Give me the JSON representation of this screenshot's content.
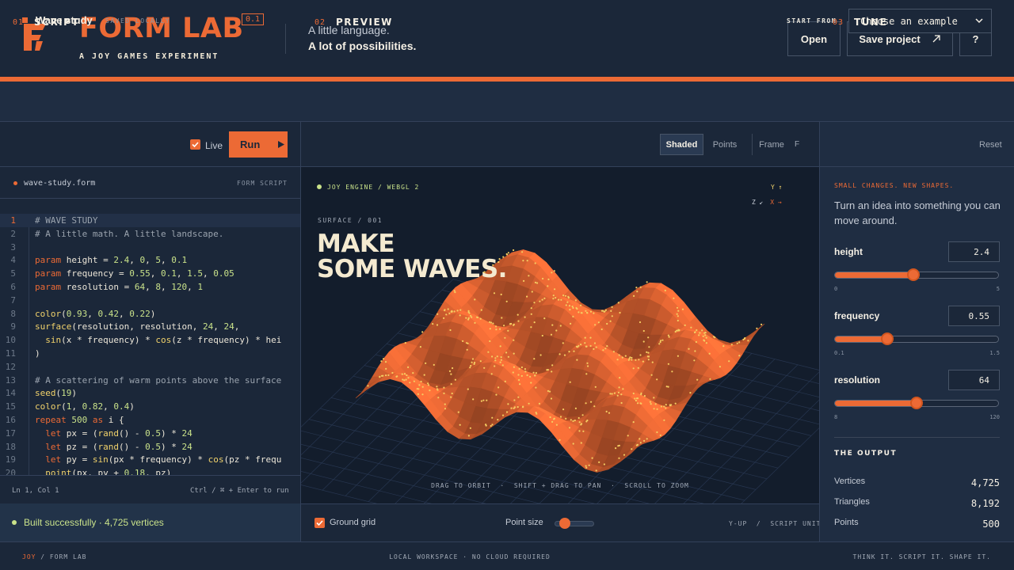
{
  "header": {
    "brand": "FORM LAB",
    "version": "0.1",
    "subtitle": "A JOY GAMES EXPERIMENT",
    "tagline_1": "A little language.",
    "tagline_2": "A lot of possibilities.",
    "open_label": "Open",
    "save_label": "Save project",
    "help_label": "?"
  },
  "project": {
    "name": "Wave study",
    "status": "SAVED LOCALLY",
    "start_from_label": "START FROM",
    "example_select": "Choose an example"
  },
  "script": {
    "num": "01",
    "title": "SCRIPT",
    "live_label": "Live",
    "live_checked": true,
    "run_label": "Run",
    "file_name": "wave-study.form",
    "file_kind": "FORM SCRIPT",
    "lines": [
      {
        "n": "1",
        "t": "# WAVE STUDY"
      },
      {
        "n": "2",
        "t": "# A little math. A little landscape."
      },
      {
        "n": "3",
        "t": ""
      },
      {
        "n": "4",
        "t": "param height = 2.4, 0, 5, 0.1"
      },
      {
        "n": "5",
        "t": "param frequency = 0.55, 0.1, 1.5, 0.05"
      },
      {
        "n": "6",
        "t": "param resolution = 64, 8, 120, 1"
      },
      {
        "n": "7",
        "t": ""
      },
      {
        "n": "8",
        "t": "color(0.93, 0.42, 0.22)"
      },
      {
        "n": "9",
        "t": "surface(resolution, resolution, 24, 24,"
      },
      {
        "n": "10",
        "t": "  sin(x * frequency) * cos(z * frequency) * hei"
      },
      {
        "n": "11",
        "t": ")"
      },
      {
        "n": "12",
        "t": ""
      },
      {
        "n": "13",
        "t": "# A scattering of warm points above the surface"
      },
      {
        "n": "14",
        "t": "seed(19)"
      },
      {
        "n": "15",
        "t": "color(1, 0.82, 0.4)"
      },
      {
        "n": "16",
        "t": "repeat 500 as i {"
      },
      {
        "n": "17",
        "t": "  let px = (rand() - 0.5) * 24"
      },
      {
        "n": "18",
        "t": "  let pz = (rand() - 0.5) * 24"
      },
      {
        "n": "19",
        "t": "  let py = sin(px * frequency) * cos(pz * frequ"
      },
      {
        "n": "20",
        "t": "  point(px, py + 0.18, pz)"
      }
    ],
    "cursor_position": "Ln 1, Col 1",
    "run_hint": "Ctrl / ⌘ + Enter to run",
    "build_status": "Built successfully · 4,725 vertices"
  },
  "preview": {
    "num": "02",
    "title": "PREVIEW",
    "modes": [
      "Shaded",
      "Points"
    ],
    "active_mode": "Shaded",
    "frame_label": "Frame",
    "frame_key": "F",
    "engine": "JOY ENGINE / WEBGL 2",
    "axis_y": "Y ↑",
    "axis_z": "Z ↙",
    "axis_x": "X →",
    "surface_tag": "SURFACE / 001",
    "headline_1": "MAKE",
    "headline_2": "SOME WAVES.",
    "hint": "DRAG TO ORBIT  ·  SHIFT + DRAG TO PAN  ·  SCROLL TO ZOOM",
    "ground_grid_label": "Ground grid",
    "ground_grid_checked": true,
    "point_size_label": "Point size",
    "point_size_fraction": 0.15,
    "orientation": "Y-UP  /  SCRIPT UNITS"
  },
  "tune": {
    "num": "03",
    "title": "TUNE",
    "reset_label": "Reset",
    "kicker": "SMALL CHANGES. NEW SHAPES.",
    "description": "Turn an idea into something you can move around.",
    "params": [
      {
        "label": "height",
        "value": "2.4",
        "min": "0",
        "max": "5",
        "fraction": 0.48
      },
      {
        "label": "frequency",
        "value": "0.55",
        "min": "0.1",
        "max": "1.5",
        "fraction": 0.32
      },
      {
        "label": "resolution",
        "value": "64",
        "min": "8",
        "max": "120",
        "fraction": 0.5
      }
    ],
    "output_title": "THE OUTPUT",
    "output": [
      {
        "k": "Vertices",
        "v": "4,725"
      },
      {
        "k": "Triangles",
        "v": "8,192"
      },
      {
        "k": "Points",
        "v": "500"
      }
    ]
  },
  "footer": {
    "joy": "JOY",
    "app": "/ FORM LAB",
    "center": "LOCAL WORKSPACE · NO CLOUD REQUIRED",
    "right": "THINK IT. SCRIPT IT. SHAPE IT."
  },
  "colors": {
    "accent": "#ec6a35",
    "background": "#1b2739",
    "point_color": "#f5cd62",
    "success": "#c9e28a"
  }
}
